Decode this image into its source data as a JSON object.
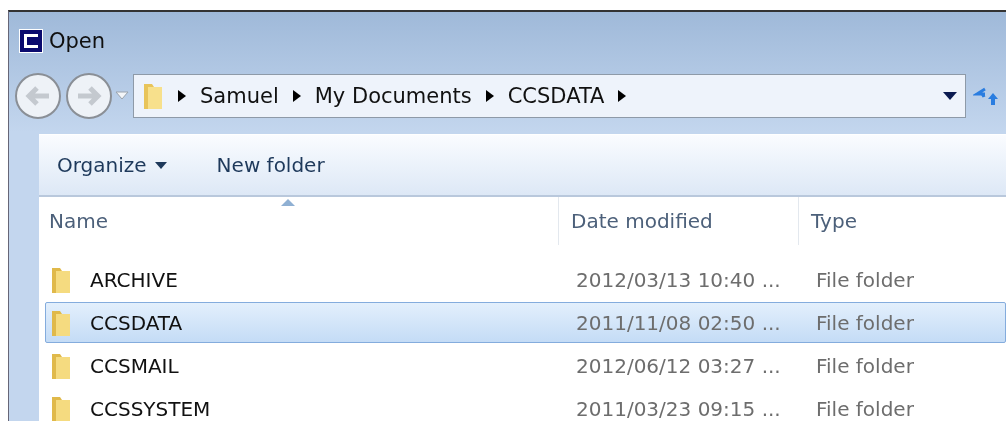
{
  "window": {
    "title": "Open"
  },
  "address": {
    "crumbs": [
      "Samuel",
      "My Documents",
      "CCSDATA"
    ]
  },
  "toolbar": {
    "organize": "Organize",
    "new_folder": "New folder"
  },
  "table": {
    "columns": [
      "Name",
      "Date modified",
      "Type"
    ],
    "rows": [
      {
        "name": "ARCHIVE",
        "date": "2012/03/13 10:40 ...",
        "type": "File folder",
        "selected": false
      },
      {
        "name": "CCSDATA",
        "date": "2011/11/08 02:50 ...",
        "type": "File folder",
        "selected": true
      },
      {
        "name": "CCSMAIL",
        "date": "2012/06/12 03:27 ...",
        "type": "File folder",
        "selected": false
      },
      {
        "name": "CCSSYSTEM",
        "date": "2011/03/23 09:15 ...",
        "type": "File folder",
        "selected": false
      }
    ]
  }
}
